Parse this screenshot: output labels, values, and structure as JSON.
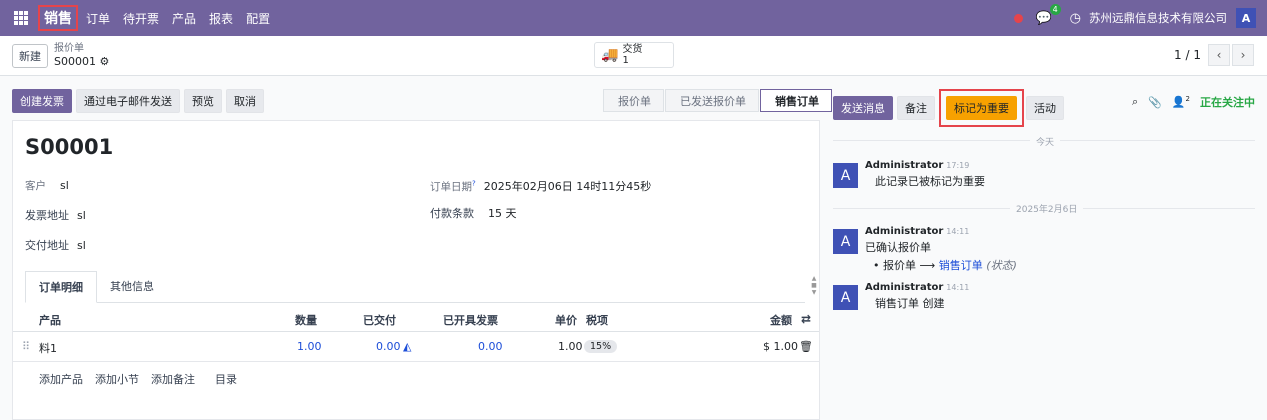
{
  "navbar": {
    "brand": "销售",
    "menu": [
      "订单",
      "待开票",
      "产品",
      "报表",
      "配置"
    ],
    "chat_badge": "4",
    "company": "苏州远鼎信息技术有限公司",
    "user_initial": "A"
  },
  "control_panel": {
    "new_button": "新建",
    "breadcrumb_parent": "报价单",
    "breadcrumb_current": "S00001",
    "delivery_label": "交货",
    "delivery_count": "1",
    "pager": "1 / 1"
  },
  "actions": [
    "创建发票",
    "通过电子邮件发送",
    "预览",
    "取消"
  ],
  "statusbar": [
    "报价单",
    "已发送报价单",
    "销售订单"
  ],
  "form": {
    "title": "S00001",
    "customer_label": "客户",
    "customer_value": "sl",
    "invoice_addr_label": "发票地址",
    "invoice_addr_value": "sl",
    "delivery_addr_label": "交付地址",
    "delivery_addr_value": "sl",
    "order_date_label": "订单日期",
    "order_date_help": "?",
    "order_date_value": "2025年02月06日 14时11分45秒",
    "payment_terms_label": "付款条款",
    "payment_terms_value": "15 天"
  },
  "tabs": [
    "订单明细",
    "其他信息"
  ],
  "table": {
    "headers": {
      "product": "产品",
      "qty": "数量",
      "delivered": "已交付",
      "invoiced": "已开具发票",
      "price": "单价",
      "tax": "税项",
      "amount": "金额"
    },
    "rows": [
      {
        "product": "料1",
        "qty": "1.00",
        "delivered": "0.00",
        "invoiced": "0.00",
        "price": "1.00",
        "tax": "15%",
        "amount": "$ 1.00"
      }
    ],
    "add_links": [
      "添加产品",
      "添加小节",
      "添加备注",
      "目录"
    ]
  },
  "chatter": {
    "buttons": {
      "send": "发送消息",
      "note": "备注",
      "mark_important": "标记为重要",
      "activity": "活动"
    },
    "followers_count": "2",
    "following_label": "正在关注中",
    "sep_today": "今天",
    "sep_date": "2025年2月6日",
    "messages": [
      {
        "author": "Administrator",
        "time": "17:19",
        "body": "此记录已被标记为重要"
      },
      {
        "author": "Administrator",
        "time": "14:11",
        "body": "已确认报价单",
        "change_from": "报价单",
        "change_arrow": "⟶",
        "change_to": "销售订单",
        "change_field": "(状态)"
      },
      {
        "author": "Administrator",
        "time": "14:11",
        "body": "销售订单 创建"
      }
    ],
    "avatar_initial": "A"
  },
  "colors": {
    "primary": "#71639e",
    "warning": "#f7a100",
    "highlight": "#e5444b"
  }
}
